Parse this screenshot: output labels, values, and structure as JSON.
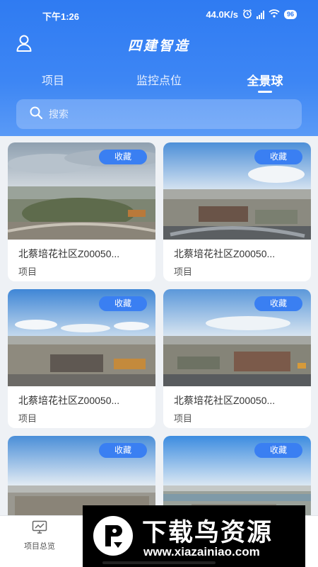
{
  "status": {
    "time": "下午1:26",
    "speed": "44.0K/s",
    "battery": "96"
  },
  "app": {
    "title": "四建智造"
  },
  "tabs": [
    {
      "label": "项目",
      "active": false
    },
    {
      "label": "监控点位",
      "active": false
    },
    {
      "label": "全景球",
      "active": true
    }
  ],
  "search": {
    "placeholder": "搜索"
  },
  "cards": [
    {
      "title": "北蔡培花社区Z00050...",
      "subtitle": "项目",
      "fav": "收藏"
    },
    {
      "title": "北蔡培花社区Z00050...",
      "subtitle": "项目",
      "fav": "收藏"
    },
    {
      "title": "北蔡培花社区Z00050...",
      "subtitle": "项目",
      "fav": "收藏"
    },
    {
      "title": "北蔡培花社区Z00050...",
      "subtitle": "项目",
      "fav": "收藏"
    },
    {
      "title": "",
      "subtitle": "",
      "fav": "收藏"
    },
    {
      "title": "",
      "subtitle": "",
      "fav": "收藏"
    }
  ],
  "bottom_nav": [
    {
      "label": "项目总览",
      "icon": "monitor-chart-icon"
    }
  ],
  "watermark": {
    "title": "下载鸟资源",
    "url": "www.xiazainiao.com"
  },
  "colors": {
    "primary": "#2f7bf2",
    "fav_badge": "#3a7ff2"
  }
}
